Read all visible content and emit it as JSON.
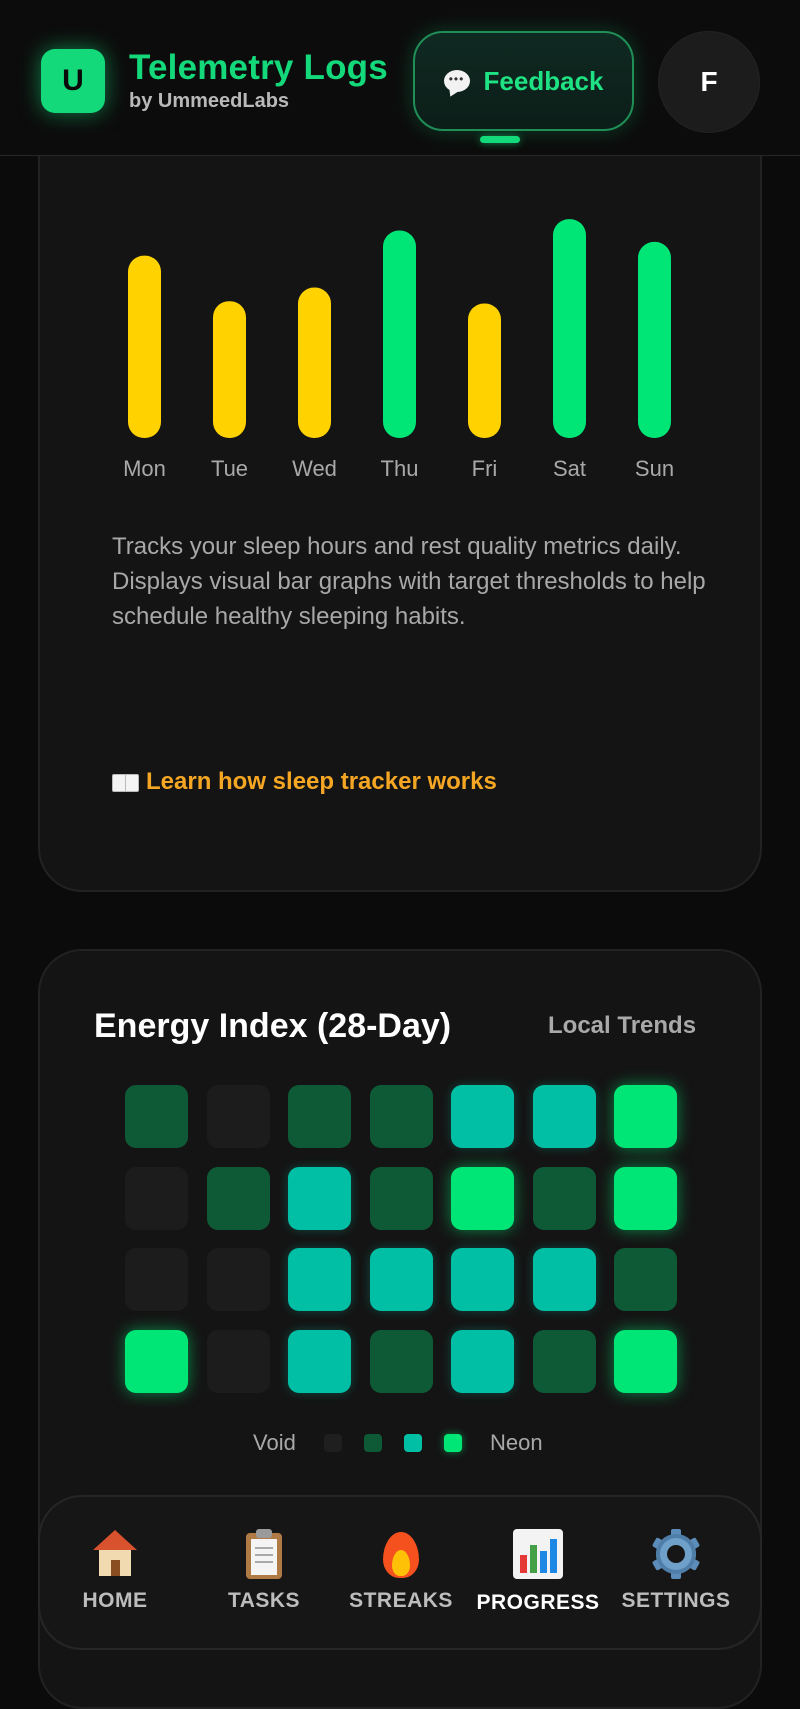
{
  "header": {
    "logo_letter": "U",
    "title": "Telemetry Logs",
    "subtitle": "by UmmeedLabs",
    "feedback_label": "Feedback",
    "avatar_initial": "F"
  },
  "sleep_card": {
    "description": "Tracks your sleep hours and rest quality metrics daily. Displays visual bar graphs with target thresholds to help schedule healthy sleeping habits.",
    "learn_link": "Learn how sleep tracker works"
  },
  "chart_data": {
    "type": "bar",
    "categories": [
      "Mon",
      "Tue",
      "Wed",
      "Thu",
      "Fri",
      "Sat",
      "Sun"
    ],
    "values": [
      0.8,
      0.6,
      0.66,
      0.91,
      0.59,
      0.96,
      0.86
    ],
    "value_unit": "fraction of bar area height",
    "colors": [
      "#ffd200",
      "#ffd200",
      "#ffd200",
      "#00e676",
      "#ffd200",
      "#00e676",
      "#00e676"
    ]
  },
  "energy_card": {
    "title": "Energy Index (28-Day)",
    "subtitle": "Local Trends",
    "grid": [
      [
        2,
        1,
        2,
        2,
        3,
        3,
        4
      ],
      [
        1,
        2,
        3,
        2,
        4,
        2,
        4
      ],
      [
        1,
        1,
        3,
        3,
        3,
        3,
        2
      ],
      [
        4,
        1,
        3,
        2,
        3,
        2,
        4
      ]
    ],
    "level_colors": [
      "#1c1c1c",
      "#1c1c1c",
      "#0f5a36",
      "#00bfa5",
      "#00e676"
    ],
    "legend_low": "Void",
    "legend_high": "Neon",
    "legend_colors": [
      "#1f1f1f",
      "#0f5a36",
      "#00bfa5",
      "#00e676"
    ]
  },
  "nav": {
    "items": [
      {
        "label": "HOME",
        "icon": "house-icon"
      },
      {
        "label": "TASKS",
        "icon": "clipboard-icon"
      },
      {
        "label": "STREAKS",
        "icon": "fire-icon"
      },
      {
        "label": "PROGRESS",
        "icon": "bar-chart-icon"
      },
      {
        "label": "SETTINGS",
        "icon": "gear-icon"
      }
    ],
    "active": "PROGRESS"
  }
}
